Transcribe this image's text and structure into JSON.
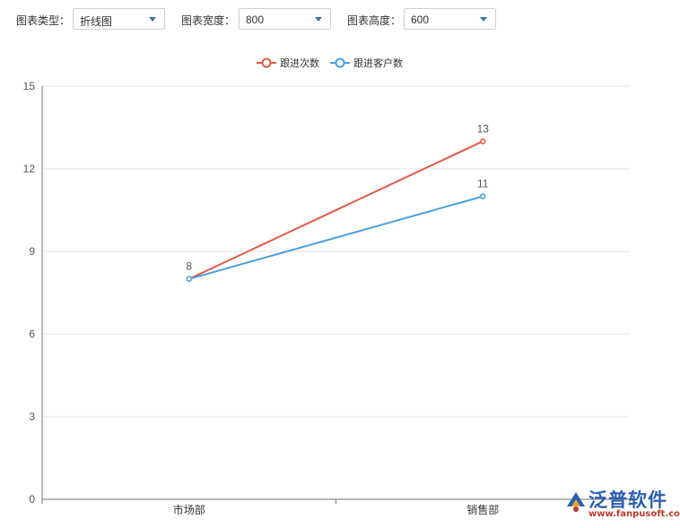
{
  "toolbar": {
    "chart_type_label": "图表类型：",
    "chart_type_value": "折线图",
    "chart_width_label": "图表宽度：",
    "chart_width_value": "800",
    "chart_height_label": "图表高度：",
    "chart_height_value": "600"
  },
  "chart_data": {
    "type": "line",
    "categories": [
      "市场部",
      "销售部"
    ],
    "series": [
      {
        "name": "跟进次数",
        "values": [
          8,
          13
        ],
        "color": "#e05a47",
        "labels": [
          "",
          "13"
        ]
      },
      {
        "name": "跟进客户数",
        "values": [
          8,
          11
        ],
        "color": "#4a9fd8",
        "labels": [
          "8",
          "11"
        ]
      }
    ],
    "yticks": [
      0,
      3,
      6,
      9,
      12,
      15
    ],
    "ylim": [
      0,
      15
    ],
    "grid": true,
    "legend_position": "top-center"
  },
  "watermark": {
    "brand": "泛普软件",
    "url": "www.fanpusoft.com"
  },
  "colors": {
    "axis": "#6e7079",
    "grid": "#e6e6e6",
    "caret": "#3d6fb3",
    "brand": "#2b5fae"
  }
}
